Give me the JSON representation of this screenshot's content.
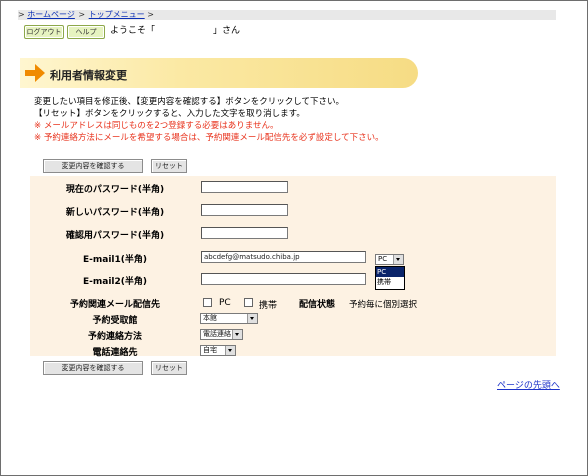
{
  "breadcrumb": {
    "prefix": ">",
    "home": "ホームページ",
    "sep": ">",
    "top_menu": "トップメニュー",
    "suffix": ">"
  },
  "header": {
    "logout_label": "ログアウト",
    "help_label": "ヘルプ",
    "welcome_prefix": "ようこそ「",
    "welcome_suffix": "」さん"
  },
  "page": {
    "title": "利用者情報変更",
    "intro_line1": "変更したい項目を修正後、【変更内容を確認する】ボタンをクリックして下さい。",
    "intro_line2": "【リセット】ボタンをクリックすると、入力した文字を取り消します。",
    "note1": "※ メールアドレスは同じものを2つ登録する必要はありません。",
    "note2": "※ 予約連絡方法にメールを希望する場合は、予約関連メール配信先を必ず設定して下さい。"
  },
  "buttons": {
    "confirm_label": "変更内容を確認する",
    "reset_label": "リセット"
  },
  "form": {
    "current_password_label": "現在のパスワード(半角)",
    "current_password_value": "",
    "new_password_label": "新しいパスワード(半角)",
    "new_password_value": "",
    "confirm_password_label": "確認用パスワード(半角)",
    "confirm_password_value": "",
    "email1_label": "E-mail1(半角)",
    "email1_value": "abcdefg@matsudo.chiba.jp",
    "email1_type_selected": "PC",
    "email1_type_options": [
      "PC",
      "携帯"
    ],
    "email2_label": "E-mail2(半角)",
    "email2_value": "",
    "mail_target_label": "予約関連メール配信先",
    "mail_target_pc": "PC",
    "mail_target_mobile": "携帯",
    "delivery_status_label": "配信状態",
    "delivery_status_value": "予約毎に個別選択",
    "pickup_library_label": "予約受取館",
    "pickup_library_value": "本館",
    "contact_method_label": "予約連絡方法",
    "contact_method_value": "電話連絡",
    "phone_contact_label": "電話連絡先",
    "phone_contact_value": "自宅"
  },
  "footer": {
    "to_top_label": "ページの先頭へ"
  }
}
